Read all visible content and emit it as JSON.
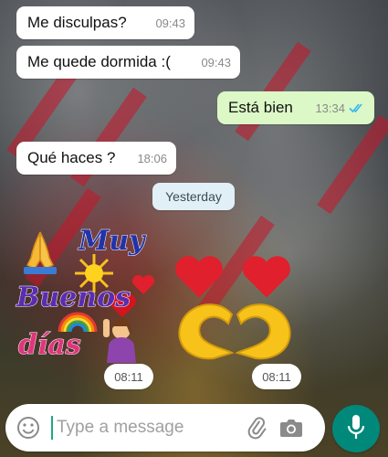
{
  "wallpaper": {
    "description_icon": "photo-wallpaper"
  },
  "messages": [
    {
      "direction": "in",
      "text": "Me disculpas?",
      "time": "09:43"
    },
    {
      "direction": "in",
      "text": "Me quede dormida :(",
      "time": "09:43"
    },
    {
      "direction": "out",
      "text": "Está bien",
      "time": "13:34",
      "status": "read"
    },
    {
      "direction": "in",
      "text": "Qué haces ?",
      "time": "18:06"
    }
  ],
  "date_divider": "Yesterday",
  "stickers": [
    {
      "icon": "buenos-dias-sticker",
      "words": [
        "Muy",
        "Buenos",
        "días"
      ],
      "time": "08:11"
    },
    {
      "icon": "heart-hands-sticker",
      "time": "08:11"
    }
  ],
  "composer": {
    "placeholder": "Type a message",
    "emoji_icon": "smiley-icon",
    "attach_icon": "paperclip-icon",
    "camera_icon": "camera-icon",
    "send_icon": "microphone-icon"
  },
  "colors": {
    "outgoing_bubble": "#dcf8c6",
    "incoming_bubble": "#ffffff",
    "accent": "#00897b",
    "read_ticks": "#34b7f1"
  }
}
